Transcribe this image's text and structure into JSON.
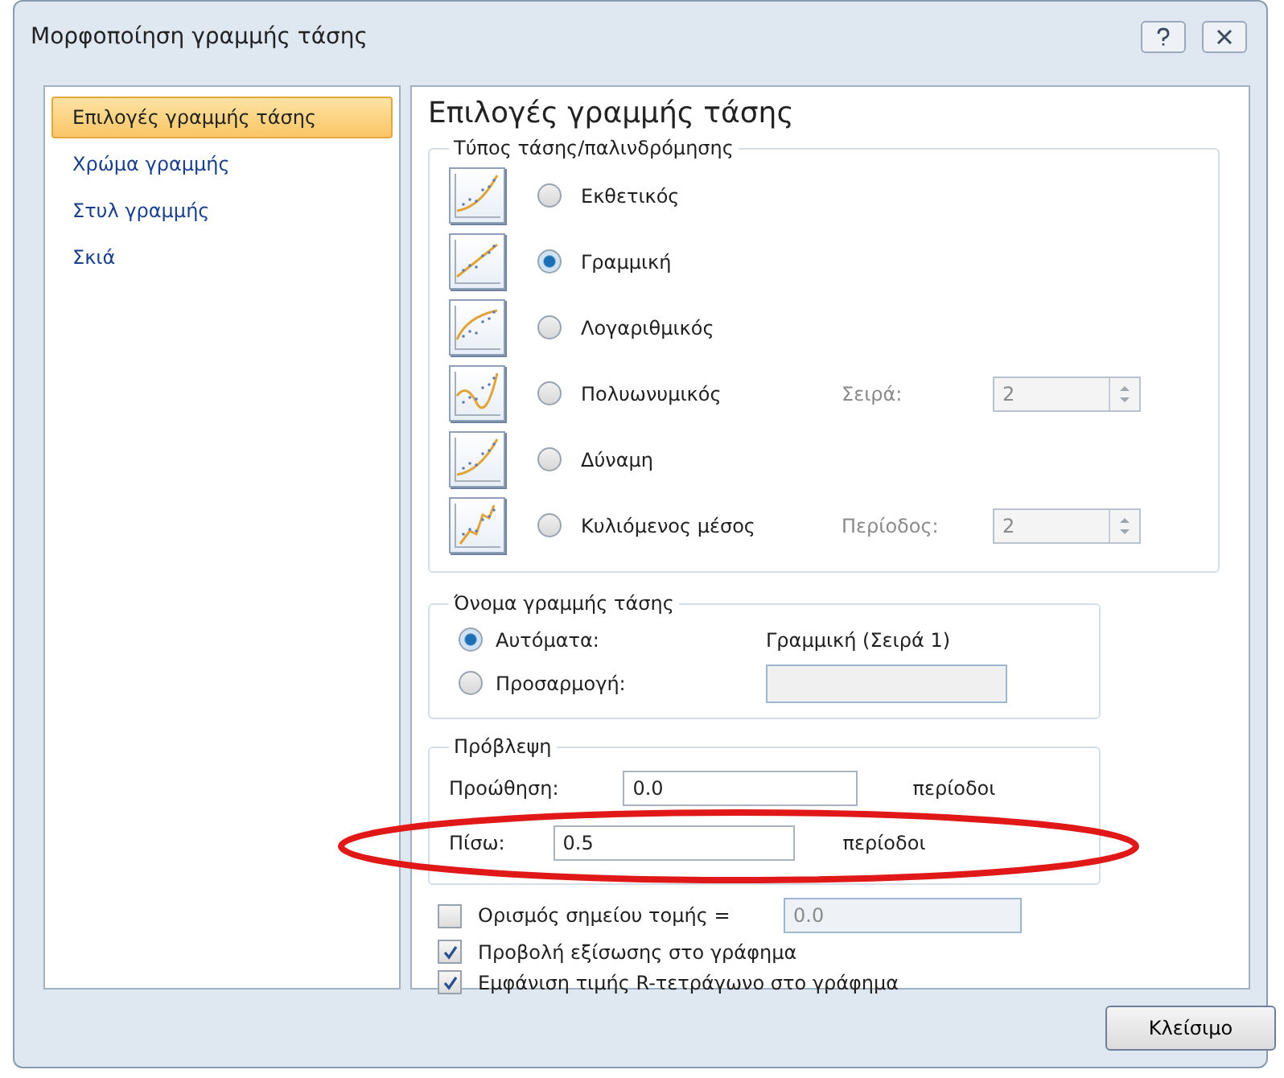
{
  "window": {
    "title": "Μορφοποίηση γραμμής τάσης"
  },
  "sidebar": {
    "items": [
      {
        "label": "Επιλογές γραμμής τάσης",
        "selected": true
      },
      {
        "label": "Χρώμα γραμμής",
        "selected": false
      },
      {
        "label": "Στυλ γραμμής",
        "selected": false
      },
      {
        "label": "Σκιά",
        "selected": false
      }
    ]
  },
  "heading": "Επιλογές γραμμής τάσης",
  "trend_type": {
    "legend": "Τύπος τάσης/παλινδρόμησης",
    "options": [
      {
        "label": "Εκθετικός",
        "selected": false,
        "kind": "exponential"
      },
      {
        "label": "Γραμμική",
        "selected": true,
        "kind": "linear"
      },
      {
        "label": "Λογαριθμικός",
        "selected": false,
        "kind": "logarithmic"
      },
      {
        "label": "Πολυωνυμικός",
        "selected": false,
        "kind": "polynomial",
        "param": {
          "label": "Σειρά:",
          "value": "2"
        }
      },
      {
        "label": "Δύναμη",
        "selected": false,
        "kind": "exponential"
      },
      {
        "label": "Κυλιόμενος μέσος",
        "selected": false,
        "kind": "average",
        "param": {
          "label": "Περίοδος:",
          "value": "2"
        }
      }
    ]
  },
  "trend_name": {
    "legend": "Όνομα γραμμής τάσης",
    "options": [
      {
        "label": "Αυτόματα:",
        "selected": true,
        "value": "Γραμμική (Σειρά 1)"
      },
      {
        "label": "Προσαρμογή:",
        "selected": false
      }
    ]
  },
  "forecast": {
    "legend": "Πρόβλεψη",
    "rows": [
      {
        "label": "Προώθηση:",
        "value": "0.0",
        "unit": "περίοδοι"
      },
      {
        "label": "Πίσω:",
        "value": "0.5",
        "unit": "περίοδοι"
      }
    ]
  },
  "checks": [
    {
      "label": "Ορισμός σημείου τομής =",
      "checked": false,
      "value": "0.0"
    },
    {
      "label": "Προβολή εξίσωσης στο γράφημα",
      "checked": true
    },
    {
      "label": "Εμφάνιση τιμής R-τετράγωνο στο γράφημα",
      "checked": true
    }
  ],
  "close_button": "Κλείσιμο"
}
